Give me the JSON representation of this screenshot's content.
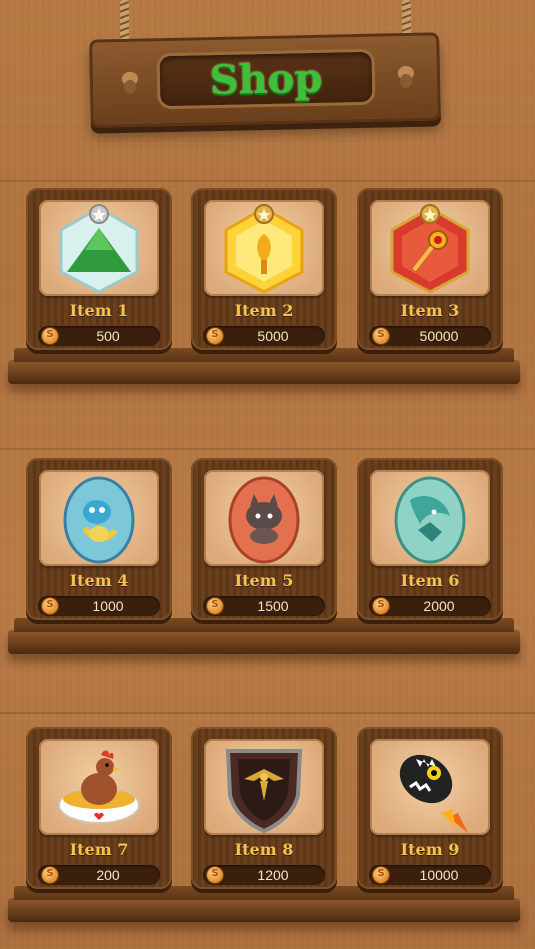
{
  "title": "Shop",
  "currency_icon": "coin-icon",
  "shelves": [
    {
      "items": [
        {
          "name": "Item 1",
          "price": "500",
          "icon": "green-mountain-gem-icon"
        },
        {
          "name": "Item 2",
          "price": "5000",
          "icon": "yellow-gem-icon"
        },
        {
          "name": "Item 3",
          "price": "50000",
          "icon": "red-gem-key-icon"
        }
      ]
    },
    {
      "items": [
        {
          "name": "Item 4",
          "price": "1000",
          "icon": "blue-dragon-egg-icon"
        },
        {
          "name": "Item 5",
          "price": "1500",
          "icon": "red-wolf-egg-icon"
        },
        {
          "name": "Item 6",
          "price": "2000",
          "icon": "teal-dragon-egg-icon"
        }
      ]
    },
    {
      "items": [
        {
          "name": "Item 7",
          "price": "200",
          "icon": "chicken-bowl-icon"
        },
        {
          "name": "Item 8",
          "price": "1200",
          "icon": "shield-icon"
        },
        {
          "name": "Item 9",
          "price": "10000",
          "icon": "rocket-bomb-icon"
        }
      ]
    }
  ]
}
